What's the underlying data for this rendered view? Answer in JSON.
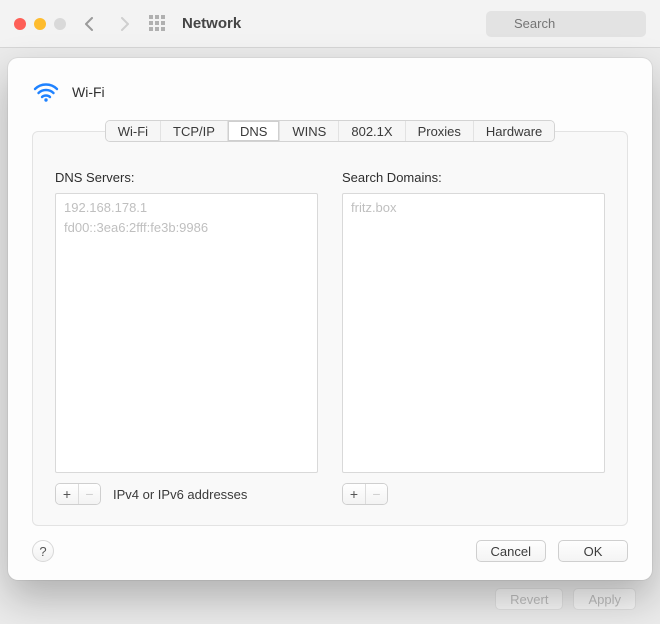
{
  "window": {
    "title": "Network",
    "search_placeholder": "Search"
  },
  "parent_footer": {
    "revert": "Revert",
    "apply": "Apply"
  },
  "sheet": {
    "title": "Wi-Fi",
    "tabs": [
      {
        "id": "wifi",
        "label": "Wi-Fi"
      },
      {
        "id": "tcpip",
        "label": "TCP/IP"
      },
      {
        "id": "dns",
        "label": "DNS",
        "active": true
      },
      {
        "id": "wins",
        "label": "WINS"
      },
      {
        "id": "8021x",
        "label": "802.1X"
      },
      {
        "id": "proxies",
        "label": "Proxies"
      },
      {
        "id": "hardware",
        "label": "Hardware"
      }
    ],
    "dns": {
      "label": "DNS Servers:",
      "hint": "IPv4 or IPv6 addresses",
      "servers": [
        "192.168.178.1",
        "fd00::3ea6:2fff:fe3b:9986"
      ]
    },
    "search_domains": {
      "label": "Search Domains:",
      "domains": [
        "fritz.box"
      ]
    },
    "buttons": {
      "help": "?",
      "cancel": "Cancel",
      "ok": "OK"
    },
    "plus": "+",
    "minus": "−"
  }
}
